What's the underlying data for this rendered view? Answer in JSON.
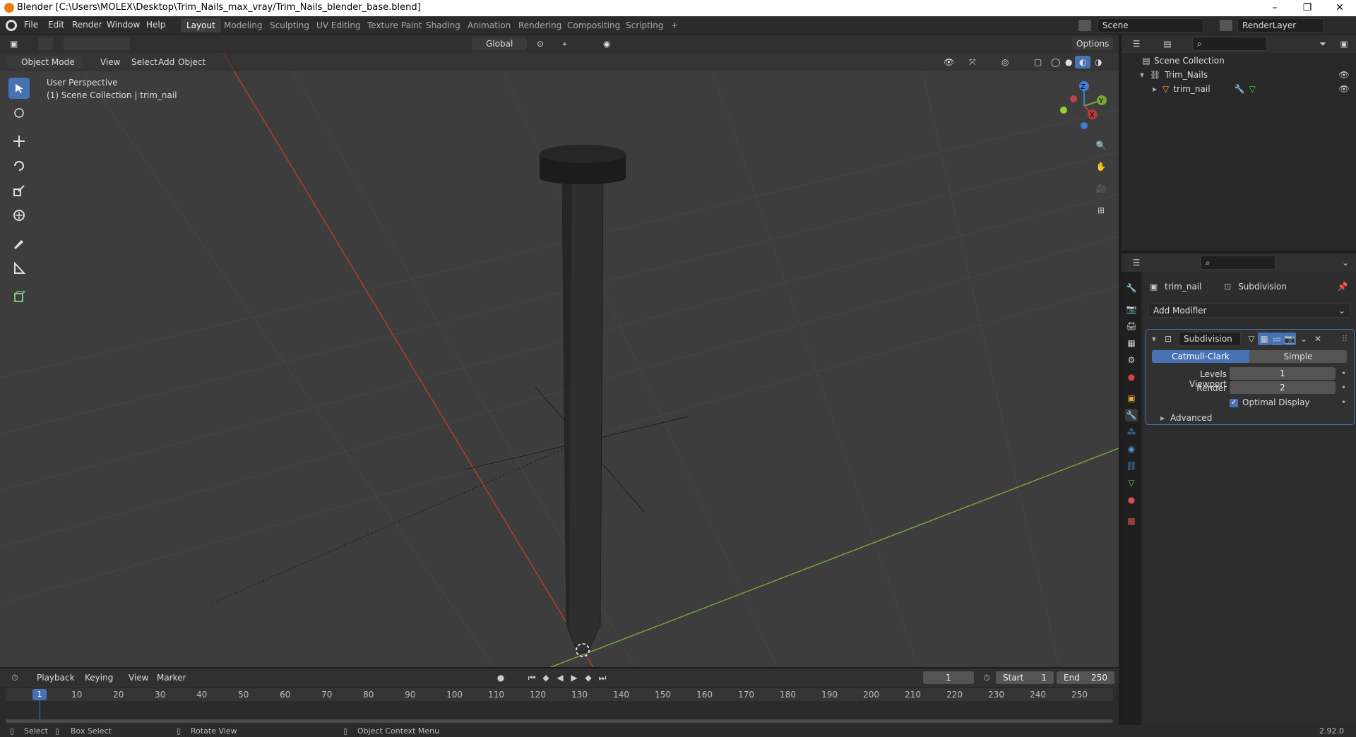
{
  "window": {
    "title": "Blender [C:\\Users\\MOLEX\\Desktop\\Trim_Nails_max_vray/Trim_Nails_blender_base.blend]",
    "controls": {
      "minimize": "–",
      "maximize": "❐",
      "close": "✕"
    }
  },
  "menu": {
    "items": [
      "File",
      "Edit",
      "Render",
      "Window",
      "Help"
    ]
  },
  "workspaces": {
    "tabs": [
      "Layout",
      "Modeling",
      "Sculpting",
      "UV Editing",
      "Texture Paint",
      "Shading",
      "Animation",
      "Rendering",
      "Compositing",
      "Scripting"
    ],
    "active": "Layout",
    "add": "+"
  },
  "scene": {
    "name": "Scene",
    "view_layer": "RenderLayer"
  },
  "viewport_header": {
    "mode": "Object Mode",
    "menus": [
      "View",
      "Select",
      "Add",
      "Object"
    ],
    "transform_orientation": "Global",
    "options": "Options"
  },
  "viewport": {
    "perspective": "User Perspective",
    "collection_info": "(1) Scene Collection | trim_nail",
    "gizmo_axes": [
      "Z",
      "Y",
      "X"
    ]
  },
  "outliner": {
    "root": "Scene Collection",
    "collection": "Trim_Nails",
    "object": "trim_nail"
  },
  "properties": {
    "object_name": "trim_nail",
    "modifier_tab": "Subdivision",
    "add_modifier": "Add Modifier",
    "modifier": {
      "name": "Subdivision",
      "types": [
        "Catmull-Clark",
        "Simple"
      ],
      "active_type": "Catmull-Clark",
      "levels_viewport_label": "Levels Viewport",
      "levels_viewport": "1",
      "render_label": "Render",
      "render": "2",
      "optimal_display_label": "Optimal Display",
      "optimal_display": true,
      "advanced": "Advanced"
    }
  },
  "timeline": {
    "menus": [
      "Playback",
      "Keying",
      "View",
      "Marker"
    ],
    "current_frame": "1",
    "start_label": "Start",
    "start": "1",
    "end_label": "End",
    "end": "250",
    "ticks": [
      "1",
      "10",
      "20",
      "30",
      "40",
      "50",
      "60",
      "70",
      "80",
      "90",
      "100",
      "110",
      "120",
      "130",
      "140",
      "150",
      "160",
      "170",
      "180",
      "190",
      "200",
      "210",
      "220",
      "230",
      "240",
      "250"
    ]
  },
  "statusbar": {
    "select": "Select",
    "box_select": "Box Select",
    "rotate_view": "Rotate View",
    "context_menu": "Object Context Menu",
    "version": "2.92.0"
  },
  "colors": {
    "accent": "#4772b3",
    "x_axis": "#b33a3a",
    "y_axis": "#7aa33a",
    "z_axis": "#3f7ed6",
    "frame_marker": "#4772b3"
  }
}
